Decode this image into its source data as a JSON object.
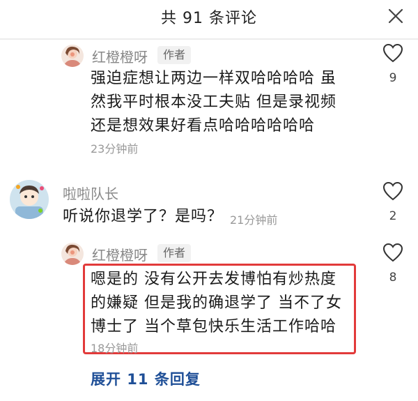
{
  "header": {
    "title": "共 91 条评论"
  },
  "comments": [
    {
      "name": "红橙橙呀",
      "badge": "作者",
      "lines": [
        "强迫症想让两边一样双哈哈哈哈 虽",
        "然我平时根本没工夫贴 但是录视频",
        "还是想效果好看点哈哈哈哈哈哈"
      ],
      "time": "23分钟前",
      "likes": "9"
    },
    {
      "name": "啦啦队长",
      "text": "听说你退学了？是吗？",
      "time": "21分钟前",
      "likes": "2"
    },
    {
      "name": "红橙橙呀",
      "badge": "作者",
      "lines": [
        "嗯是的 没有公开去发博怕有炒热度",
        "的嫌疑 但是我的确退学了 当不了女",
        "博士了 当个草包快乐生活工作哈哈"
      ],
      "time": "18分钟前",
      "likes": "8"
    }
  ],
  "expand_label": "展开 11 条回复",
  "colors": {
    "highlight": "#e23a3a",
    "link": "#1f4f97"
  }
}
